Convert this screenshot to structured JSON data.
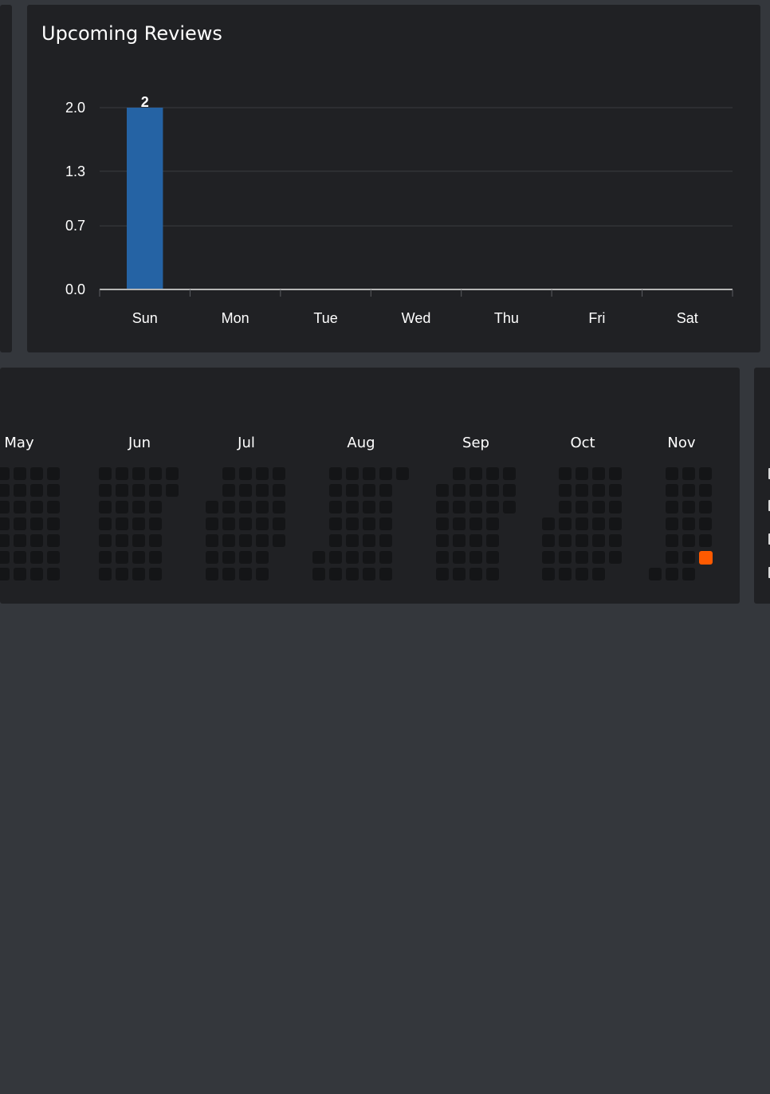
{
  "reviews_panel": {
    "title": "Upcoming Reviews"
  },
  "chart_data": {
    "type": "bar",
    "title": "Upcoming Reviews",
    "categories": [
      "Sun",
      "Mon",
      "Tue",
      "Wed",
      "Thu",
      "Fri",
      "Sat"
    ],
    "values": [
      2,
      0,
      0,
      0,
      0,
      0,
      0
    ],
    "data_labels": [
      "2",
      "",
      "",
      "",
      "",
      "",
      ""
    ],
    "yticks": [
      "0.0",
      "0.7",
      "1.3",
      "2.0"
    ],
    "ylim": [
      0,
      2
    ],
    "grid": true,
    "bar_color": "#2563a4"
  },
  "heatmap": {
    "months": [
      "May",
      "Jun",
      "Jul",
      "Aug",
      "Sep",
      "Oct",
      "Nov"
    ],
    "cell_color": "#141517",
    "highlight_color": "#ff5a00",
    "highlighted_cells": 1
  },
  "colors": {
    "page_background": "#34373c",
    "panel_background": "#202124",
    "accent_bar": "#2563a4",
    "highlight": "#ff5a00"
  }
}
